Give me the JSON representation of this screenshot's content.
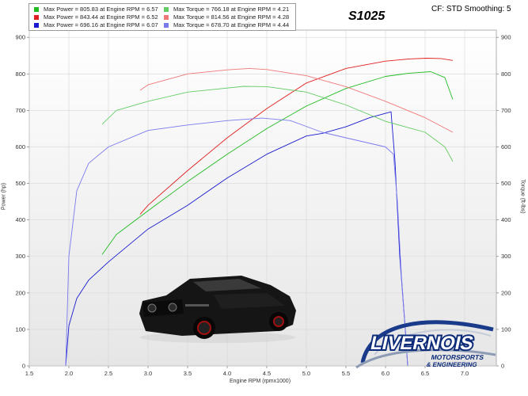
{
  "title": "S1025",
  "header_right": "CF: STD Smoothing: 5",
  "legend": {
    "power": [
      {
        "label": "Max Power = 805.83 at Engine RPM = 6.57",
        "color": "#22bb22"
      },
      {
        "label": "Max Power = 843.44 at Engine RPM = 6.52",
        "color": "#e02020"
      },
      {
        "label": "Max Power = 696.16 at Engine RPM = 6.07",
        "color": "#1a1ad0"
      }
    ],
    "torque": [
      {
        "label": "Max Torque = 766.18 at Engine RPM = 4.21",
        "color": "#66cc66"
      },
      {
        "label": "Max Torque = 814.56 at Engine RPM = 4.28",
        "color": "#f07878"
      },
      {
        "label": "Max Torque = 678.70 at Engine RPM = 4.44",
        "color": "#7a7aee"
      }
    ]
  },
  "logo": {
    "line1": "LIVERNOIS",
    "line2": "MOTORSPORTS",
    "line3": "& ENGINEERING"
  },
  "chart_data": {
    "type": "line",
    "xlabel": "Engine RPM (rpmx1000)",
    "ylabel": "Power (hp)",
    "ylabel_right": "Torque (ft-lbs)",
    "xlim": [
      1.5,
      7.4
    ],
    "ylim": [
      0,
      920
    ],
    "xticks": [
      "1.5",
      "2.0",
      "2.5",
      "3.0",
      "3.5",
      "4.0",
      "4.5",
      "5.0",
      "5.5",
      "6.0",
      "6.5",
      "7.0"
    ],
    "yticks": [
      "0",
      "100",
      "200",
      "300",
      "400",
      "500",
      "600",
      "700",
      "800",
      "900"
    ],
    "grid": true,
    "legend_position": "top-left",
    "series": [
      {
        "name": "Max Power = 805.83 at Engine RPM = 6.57",
        "color": "#22bb22",
        "x": [
          2.42,
          2.6,
          3.0,
          3.5,
          4.0,
          4.5,
          5.0,
          5.5,
          6.0,
          6.3,
          6.57,
          6.75,
          6.85
        ],
        "y": [
          305,
          360,
          425,
          505,
          580,
          650,
          712,
          760,
          793,
          802,
          806,
          790,
          730
        ]
      },
      {
        "name": "Max Power = 843.44 at Engine RPM = 6.52",
        "color": "#e02020",
        "x": [
          2.9,
          3.0,
          3.5,
          4.0,
          4.5,
          5.0,
          5.5,
          6.0,
          6.3,
          6.52,
          6.7,
          6.85
        ],
        "y": [
          415,
          440,
          535,
          625,
          705,
          775,
          815,
          835,
          841,
          843,
          842,
          837
        ]
      },
      {
        "name": "Max Power = 696.16 at Engine RPM = 6.07",
        "color": "#1a1ad0",
        "x": [
          1.96,
          2.0,
          2.1,
          2.25,
          2.5,
          3.0,
          3.5,
          4.0,
          4.5,
          5.0,
          5.2,
          5.5,
          5.8,
          6.07,
          6.12,
          6.18,
          6.25,
          6.28
        ],
        "y": [
          0,
          110,
          185,
          235,
          285,
          375,
          440,
          515,
          580,
          630,
          637,
          655,
          680,
          696,
          560,
          300,
          100,
          0
        ]
      },
      {
        "name": "Max Torque = 766.18 at Engine RPM = 4.21",
        "color": "#66cc66",
        "x": [
          2.42,
          2.6,
          3.0,
          3.5,
          4.21,
          4.5,
          5.0,
          5.5,
          6.0,
          6.5,
          6.75,
          6.85
        ],
        "y": [
          662,
          700,
          725,
          750,
          766,
          765,
          750,
          715,
          670,
          640,
          600,
          560
        ]
      },
      {
        "name": "Max Torque = 814.56 at Engine RPM = 4.28",
        "color": "#f07878",
        "x": [
          2.9,
          3.0,
          3.5,
          4.0,
          4.28,
          4.5,
          5.0,
          5.5,
          6.0,
          6.5,
          6.85
        ],
        "y": [
          755,
          770,
          800,
          811,
          815,
          812,
          795,
          765,
          725,
          680,
          640
        ]
      },
      {
        "name": "Max Torque = 678.70 at Engine RPM = 4.44",
        "color": "#7a7aee",
        "x": [
          1.96,
          2.0,
          2.1,
          2.25,
          2.5,
          3.0,
          3.5,
          4.0,
          4.44,
          4.8,
          5.2,
          5.5,
          6.0,
          6.1,
          6.15,
          6.2,
          6.25,
          6.28
        ],
        "y": [
          0,
          300,
          480,
          555,
          600,
          645,
          660,
          672,
          679,
          672,
          640,
          625,
          600,
          580,
          450,
          250,
          100,
          0
        ]
      }
    ]
  }
}
